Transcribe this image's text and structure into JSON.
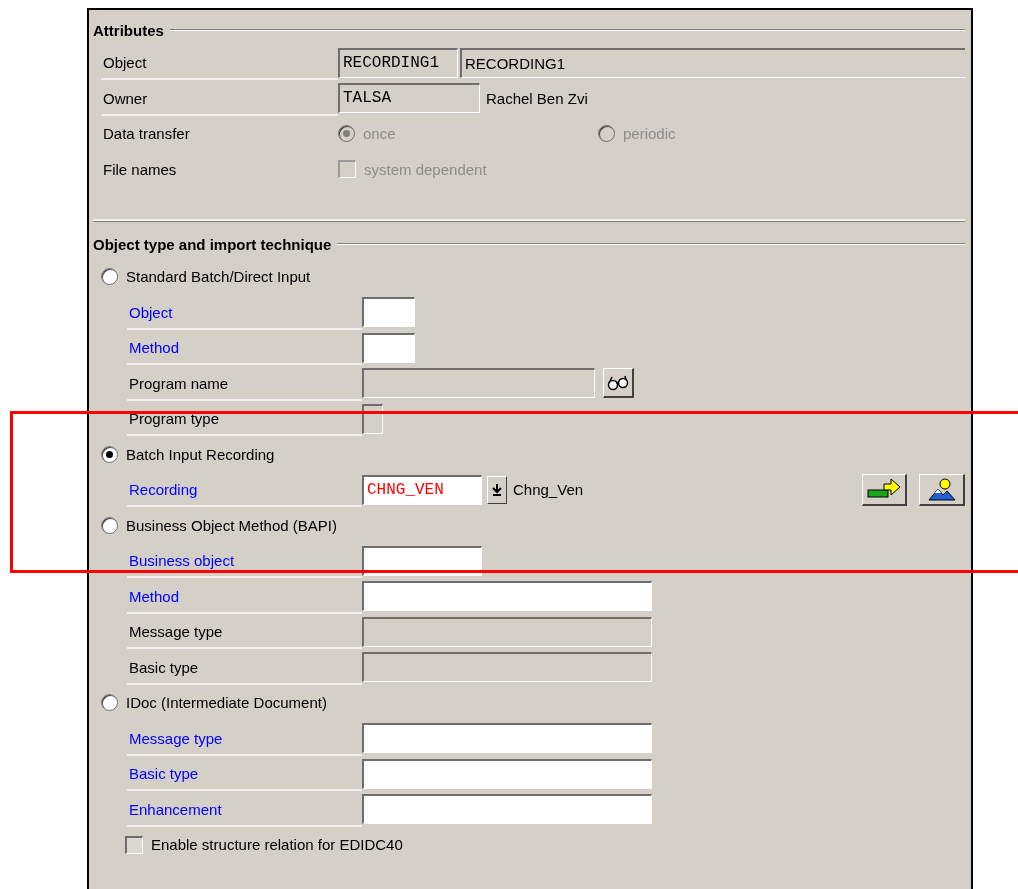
{
  "attributes": {
    "title": "Attributes",
    "rows": [
      {
        "kind": "double",
        "label": "Object",
        "value": "RECORDING1",
        "description": "RECORDING1"
      },
      {
        "kind": "field",
        "label": "Owner",
        "value": "TALSA",
        "description": "Rachel Ben Zvi"
      },
      {
        "kind": "radios",
        "label": "Data transfer",
        "options": [
          {
            "label": "once",
            "selected": true,
            "disabled": true
          },
          {
            "label": "periodic",
            "selected": false,
            "disabled": true
          }
        ]
      },
      {
        "kind": "checkbox",
        "label": "File names",
        "option": "system dependent",
        "checked": false,
        "disabled": true
      }
    ]
  },
  "technique": {
    "title": "Object type and import technique",
    "options": [
      {
        "label": "Standard Batch/Direct Input",
        "selected": false,
        "fields": [
          {
            "label": "Object",
            "emphasized": true,
            "kind": "short",
            "disabled": false
          },
          {
            "label": "Method",
            "emphasized": true,
            "kind": "short",
            "disabled": false
          },
          {
            "label": "Program name",
            "emphasized": false,
            "kind": "search",
            "disabled": true
          },
          {
            "label": "Program type",
            "emphasized": false,
            "kind": "tiny",
            "disabled": true
          }
        ]
      },
      {
        "label": "Batch Input Recording",
        "selected": true,
        "fields": [
          {
            "label": "Recording",
            "emphasized": true,
            "kind": "recording",
            "disabled": false,
            "value": "CHNG_VEN",
            "description": "Chng_Ven"
          }
        ]
      },
      {
        "label": "Business Object Method (BAPI)",
        "selected": false,
        "fields": [
          {
            "label": "Business object",
            "emphasized": true,
            "kind": "medium",
            "disabled": false
          },
          {
            "label": "Method",
            "emphasized": true,
            "kind": "long",
            "disabled": false
          },
          {
            "label": "Message type",
            "emphasized": false,
            "kind": "long",
            "disabled": true
          },
          {
            "label": "Basic type",
            "emphasized": false,
            "kind": "long",
            "disabled": true
          }
        ]
      },
      {
        "label": "IDoc (Intermediate Document)",
        "selected": false,
        "fields": [
          {
            "label": "Message type",
            "emphasized": true,
            "kind": "long",
            "disabled": false
          },
          {
            "label": "Basic type",
            "emphasized": true,
            "kind": "long",
            "disabled": false
          },
          {
            "label": "Enhancement",
            "emphasized": true,
            "kind": "long",
            "disabled": false
          }
        ]
      }
    ],
    "checkbox": {
      "label": "Enable structure relation for EDIDC40",
      "checked": false
    }
  }
}
